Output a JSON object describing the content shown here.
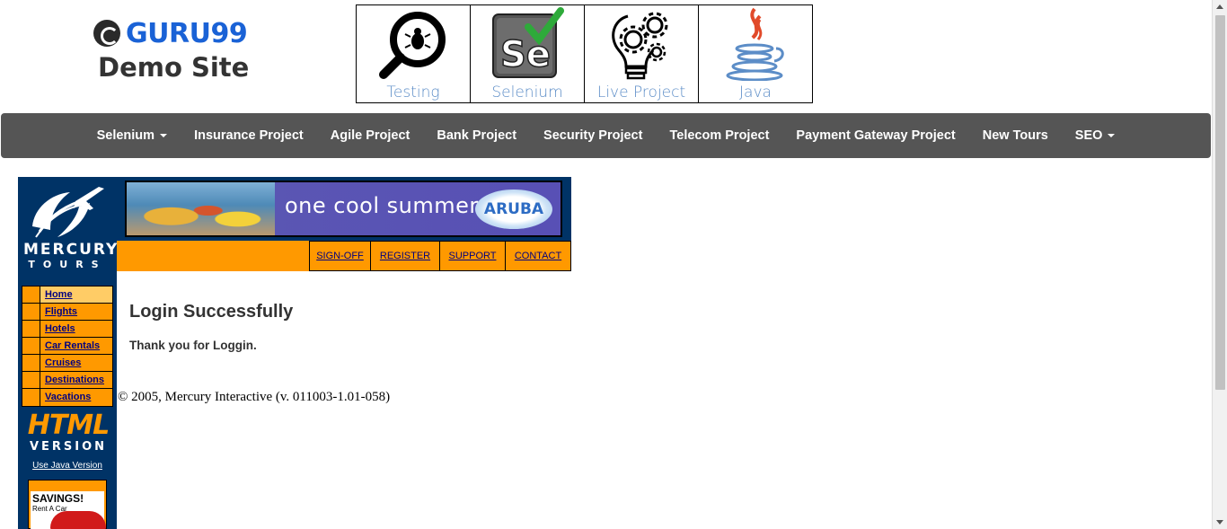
{
  "logo": {
    "brand": "GURU99",
    "subtitle": "Demo Site"
  },
  "tiles": [
    {
      "label": "Testing",
      "icon": "magnifier-bug-icon"
    },
    {
      "label": "Selenium",
      "icon": "selenium-icon"
    },
    {
      "label": "Live Project",
      "icon": "lightbulb-gears-icon"
    },
    {
      "label": "Java",
      "icon": "java-cup-icon"
    }
  ],
  "nav": {
    "selenium": "Selenium",
    "insurance": "Insurance Project",
    "agile": "Agile Project",
    "bank": "Bank Project",
    "security": "Security Project",
    "telecom": "Telecom Project",
    "payment": "Payment Gateway Project",
    "newtours": "New Tours",
    "seo": "SEO"
  },
  "mercury": {
    "logo_word": "MERCURY",
    "logo_sub": "TOURS",
    "banner_text": "one cool summer",
    "banner_brand": "ARUBA",
    "top_links": [
      "SIGN-OFF",
      "REGISTER",
      "SUPPORT",
      "CONTACT"
    ],
    "side_menu": [
      "Home",
      "Flights",
      "Hotels",
      "Car Rentals",
      "Cruises",
      "Destinations",
      "Vacations"
    ],
    "html_word": "HTML",
    "version_word": "VERSION",
    "java_link": "Use Java Version",
    "ad_title": "SAVINGS!",
    "ad_sub": "Rent A Car"
  },
  "content": {
    "title": "Login Successfully",
    "message": "Thank you for Loggin.",
    "copyright": "© 2005, Mercury Interactive (v. 011003-1.01-058)"
  },
  "colors": {
    "brand_blue": "#1a62d6",
    "navbar": "#555555",
    "mercury_navy": "#003366",
    "mercury_orange": "#ff9900",
    "link": "#000080"
  }
}
